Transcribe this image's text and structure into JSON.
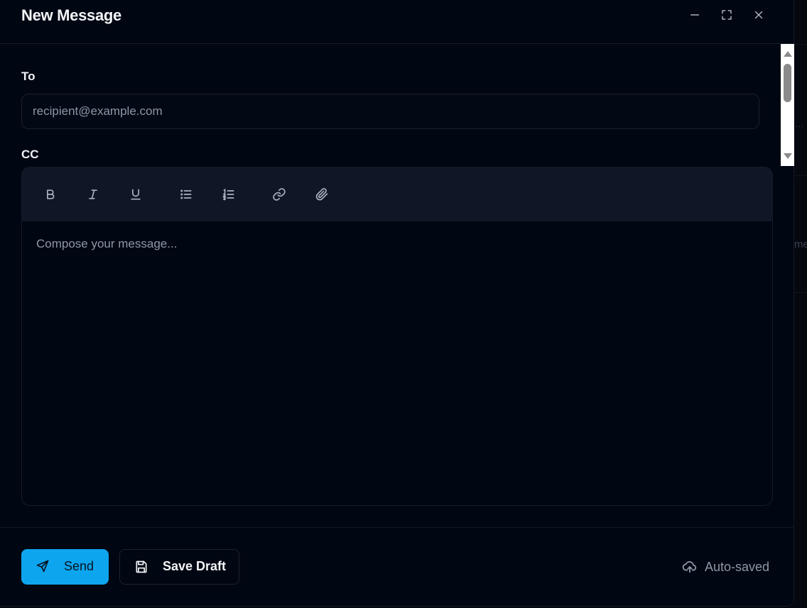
{
  "dialog": {
    "title": "New Message",
    "window_controls": [
      "minimize-icon",
      "maximize-icon",
      "close-icon"
    ]
  },
  "form": {
    "to_label": "To",
    "to_placeholder": "recipient@example.com",
    "cc_label": "CC"
  },
  "editor": {
    "toolbar": [
      "bold-icon",
      "italic-icon",
      "underline-icon",
      "bullet-list-icon",
      "numbered-list-icon",
      "link-icon",
      "attachment-icon"
    ],
    "placeholder": "Compose your message..."
  },
  "footer": {
    "send_label": "Send",
    "draft_label": "Save Draft",
    "autosave_label": "Auto-saved"
  },
  "background": {
    "partial_text": "me",
    "dots": "..."
  },
  "colors": {
    "accent": "#0ea5ef",
    "background": "#000612",
    "toolbar": "#0f1626"
  }
}
